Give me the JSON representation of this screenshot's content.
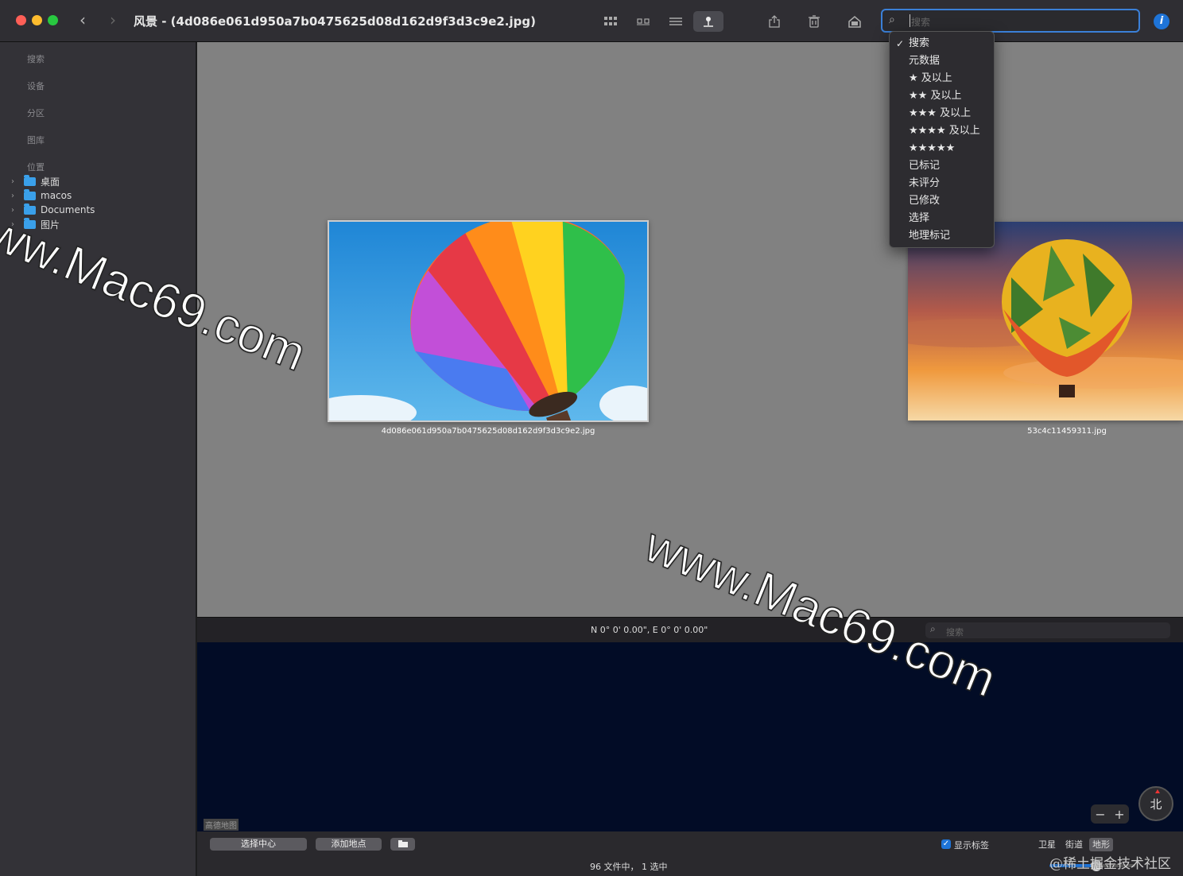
{
  "window": {
    "title": "风景 - (4d086e061d950a7b0475625d08d162d9f3d3c9e2.jpg)",
    "back_glyph": "‹",
    "forward_glyph": "›"
  },
  "toolbar": {
    "icons": [
      "grid-view-icon",
      "filmstrip-view-icon",
      "list-view-icon",
      "map-view-icon",
      "share-icon",
      "trash-icon",
      "rotate-icon"
    ],
    "search_placeholder": "搜索",
    "search_glyph": "⌕",
    "info_glyph": "i"
  },
  "search_menu": {
    "items": [
      {
        "label": "搜索",
        "checked": true
      },
      {
        "label": "元数据",
        "checked": false
      },
      {
        "label": "★ 及以上",
        "checked": false
      },
      {
        "label": "★★ 及以上",
        "checked": false
      },
      {
        "label": "★★★ 及以上",
        "checked": false
      },
      {
        "label": "★★★★ 及以上",
        "checked": false
      },
      {
        "label": "★★★★★",
        "checked": false
      },
      {
        "label": "已标记",
        "checked": false
      },
      {
        "label": "未评分",
        "checked": false
      },
      {
        "label": "已修改",
        "checked": false
      },
      {
        "label": "选择",
        "checked": false
      },
      {
        "label": "地理标记",
        "checked": false
      }
    ],
    "check_glyph": "✓"
  },
  "sidebar": {
    "sections": [
      "搜索",
      "设备",
      "分区",
      "图库",
      "位置"
    ],
    "items": [
      {
        "label": "桌面"
      },
      {
        "label": "macos"
      },
      {
        "label": "Documents"
      },
      {
        "label": "图片"
      }
    ]
  },
  "browser": {
    "images": [
      {
        "filename": "4d086e061d950a7b0475625d08d162d9f3d3c9e2.jpg",
        "selected": true
      },
      {
        "filename": "53c4c11459311.jpg",
        "selected": false
      }
    ]
  },
  "map": {
    "coordinates": "N 0° 0' 0.00\", E 0° 0' 0.00\"",
    "search_placeholder": "搜索",
    "link_label": "高德地图",
    "compass_label": "北",
    "zoom_out": "−",
    "zoom_in": "+"
  },
  "bottom": {
    "select_center": "选择中心",
    "add_location": "添加地点",
    "show_labels": "显示标签",
    "show_labels_checked": true,
    "map_types": [
      "卫星",
      "街道",
      "地形"
    ],
    "selected_map_type": "地形",
    "status": "96 文件中， 1 选中",
    "thumbnail_size": 0.55
  },
  "watermarks": [
    "www.Mac69.com",
    "www.Mac69.com",
    "@稀土掘金技术社区"
  ],
  "colors": {
    "accent": "#1e74d8",
    "content_bg": "#818181",
    "map_bg": "#020c26",
    "sidebar_bg": "#333237"
  }
}
